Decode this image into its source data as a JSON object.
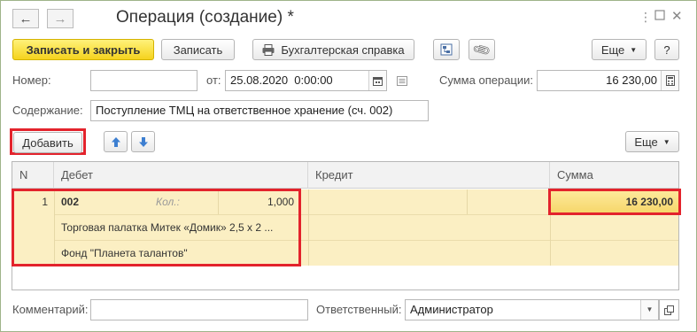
{
  "window": {
    "title": "Операция (создание) *",
    "back_icon": "←",
    "forward_icon": "→"
  },
  "toolbar": {
    "save_close_label": "Записать и закрыть",
    "save_label": "Записать",
    "report_label": "Бухгалтерская справка",
    "more_label": "Еще",
    "help_label": "?"
  },
  "form": {
    "number_label": "Номер:",
    "number_value": "",
    "date_label": "от:",
    "date_value": "25.08.2020  0:00:00",
    "amount_label": "Сумма операции:",
    "amount_value": "16 230,00",
    "content_label": "Содержание:",
    "content_value": "Поступление ТМЦ на ответственное хранение (сч. 002)"
  },
  "table_toolbar": {
    "add_label": "Добавить",
    "more_label": "Еще"
  },
  "table": {
    "headers": {
      "n": "N",
      "debit": "Дебет",
      "credit": "Кредит",
      "sum": "Сумма"
    },
    "rows": [
      {
        "n": "1",
        "account": "002",
        "qty_label": "Кол.:",
        "qty_value": "1,000",
        "subconto1": "Торговая палатка Митек «Домик» 2,5 х 2 ...",
        "subconto2": "Фонд \"Планета талантов\"",
        "sum": "16 230,00"
      }
    ]
  },
  "footer": {
    "comment_label": "Комментарий:",
    "comment_value": "",
    "responsible_label": "Ответственный:",
    "responsible_value": "Администратор"
  }
}
